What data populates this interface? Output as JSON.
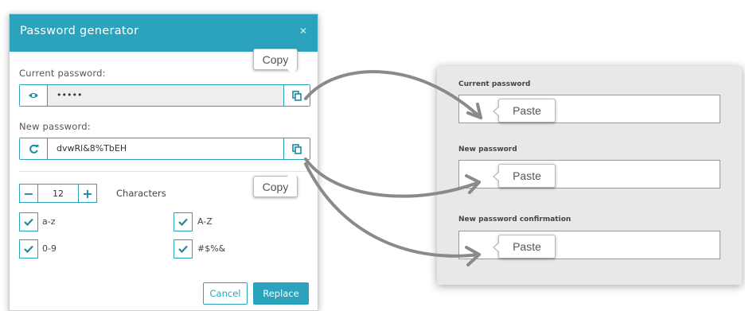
{
  "dialog": {
    "title": "Password generator",
    "close_icon": "close-icon",
    "current_label": "Current password:",
    "current_value": "•••••",
    "new_label": "New password:",
    "new_value": "dvwRl&8%TbEH",
    "characters": {
      "value": "12",
      "minus": "−",
      "plus": "+",
      "label": "Characters"
    },
    "checks": [
      {
        "label": "a-z",
        "checked": true
      },
      {
        "label": "A-Z",
        "checked": true
      },
      {
        "label": "0-9",
        "checked": true
      },
      {
        "label": "#$%&",
        "checked": true
      }
    ],
    "cancel_label": "Cancel",
    "replace_label": "Replace",
    "copy_tip": "Copy"
  },
  "target": {
    "fields": [
      {
        "label": "Current password"
      },
      {
        "label": "New password"
      },
      {
        "label": "New password confirmation"
      }
    ],
    "paste_tip": "Paste"
  },
  "colors": {
    "accent": "#2ba3bd",
    "arrow": "#8a8a8a",
    "panel": "#e8e8e8"
  }
}
